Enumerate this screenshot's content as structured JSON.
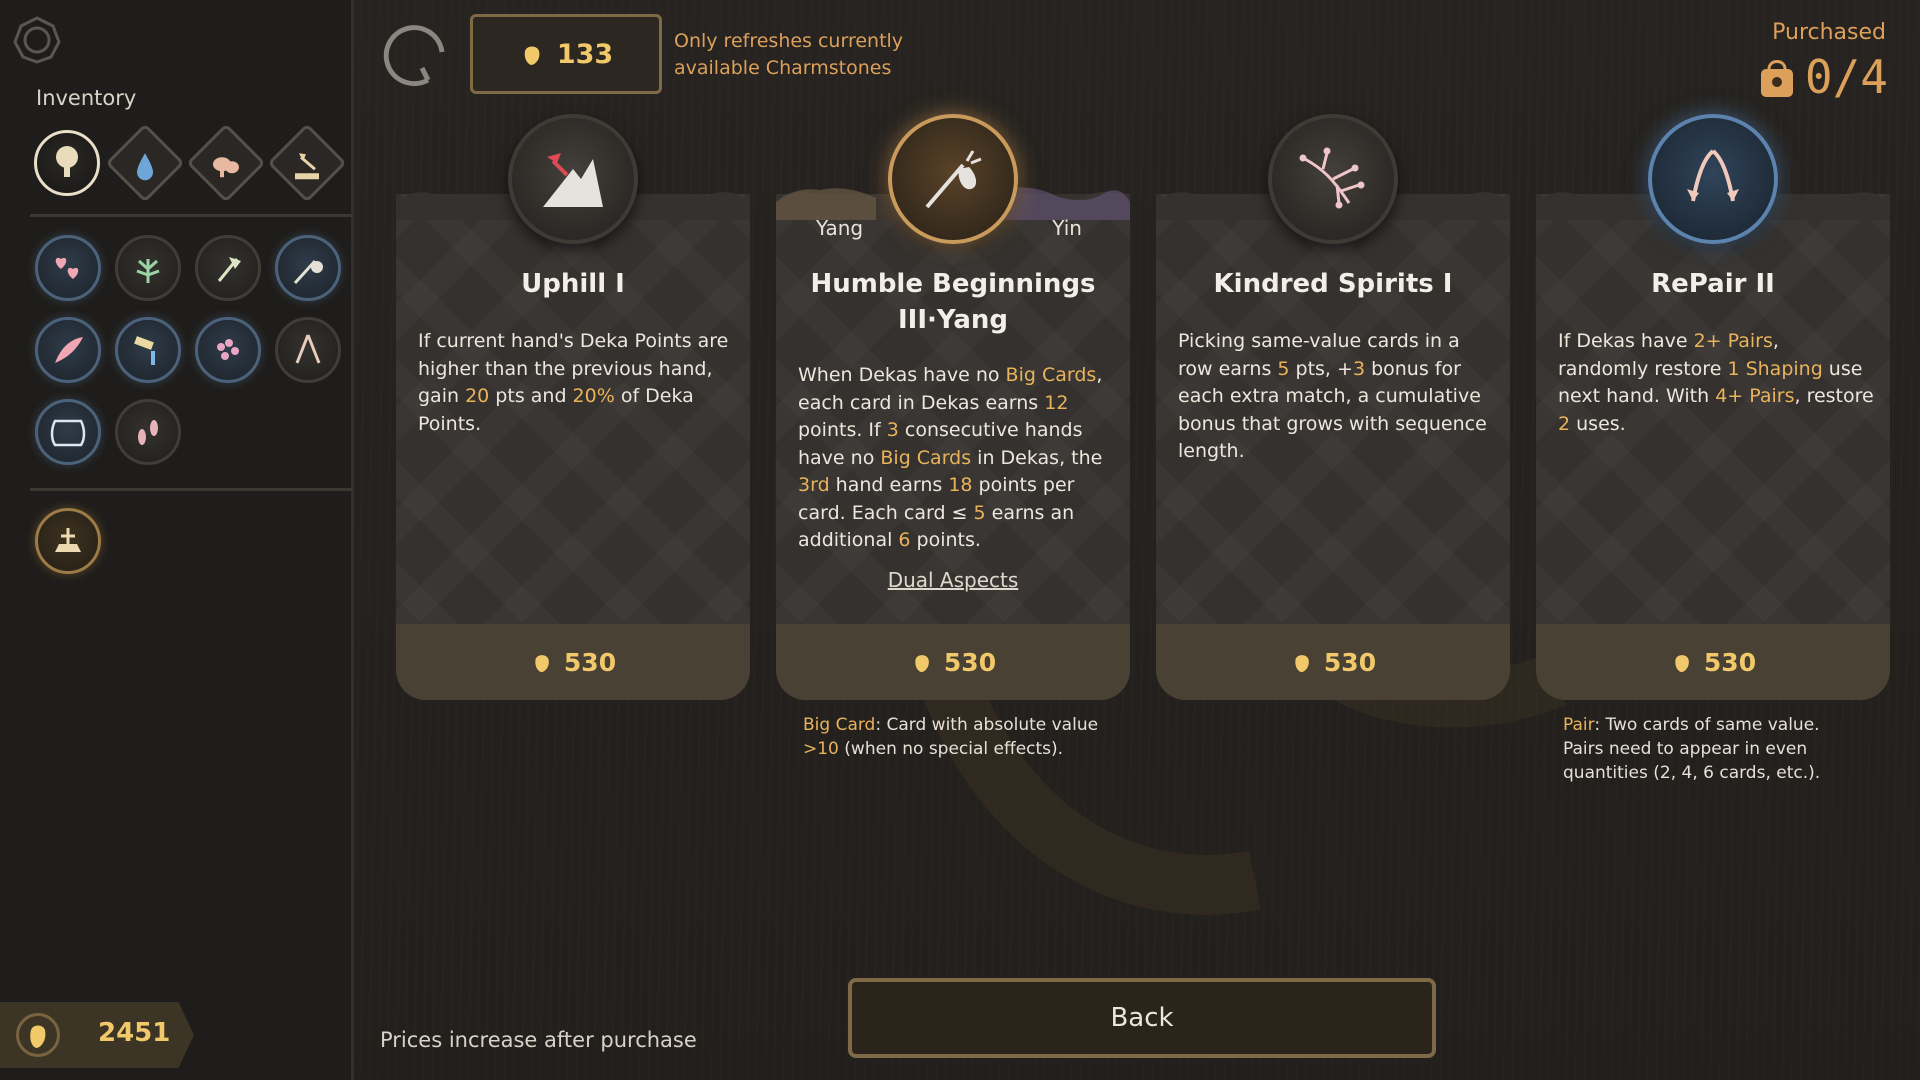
{
  "colors": {
    "accent": "#f2c96a",
    "highlight": "#e9b35b",
    "note": "#dca05a",
    "blue_rarity": "#5b83ad",
    "gold_rarity": "#c89a5c"
  },
  "sidebar": {
    "settings_icon": "gear-icon",
    "inventory_label": "Inventory",
    "categories": [
      {
        "icon": "tree-icon",
        "active": true
      },
      {
        "icon": "water-drop-icon",
        "active": false
      },
      {
        "icon": "mushroom-icon",
        "active": false
      },
      {
        "icon": "axe-stump-icon",
        "active": false
      }
    ],
    "charmstones": [
      {
        "icon": "hearts-icon",
        "rarity": "blue"
      },
      {
        "icon": "sprout-icon",
        "rarity": "gray"
      },
      {
        "icon": "axe-icon",
        "rarity": "gray"
      },
      {
        "icon": "staff-icon",
        "rarity": "blue"
      },
      {
        "icon": "feather-icon",
        "rarity": "blue"
      },
      {
        "icon": "pouring-icon",
        "rarity": "blue"
      },
      {
        "icon": "berries-icon",
        "rarity": "blue"
      },
      {
        "icon": "tweezers-icon",
        "rarity": "gray"
      },
      {
        "icon": "jar-icon",
        "rarity": "blue"
      },
      {
        "icon": "footprints-icon",
        "rarity": "gray"
      }
    ],
    "special": {
      "icon": "shrine-icon",
      "rarity": "gold"
    },
    "balance": "2451"
  },
  "topbar": {
    "refresh_cost": "133",
    "refresh_note": "Only refreshes currently available Charmstones",
    "purchased_label": "Purchased",
    "purchased_count": "0/4"
  },
  "cards": [
    {
      "icon": "mountain-pick-icon",
      "title": "Uphill I",
      "description": [
        {
          "t": "If current hand's Deka Points are higher than the previous hand, gain "
        },
        {
          "t": "20",
          "h": true
        },
        {
          "t": " pts and "
        },
        {
          "t": "20%",
          "h": true
        },
        {
          "t": " of Deka Points."
        }
      ],
      "price": "530"
    },
    {
      "icon": "staff-icon",
      "yang_label": "Yang",
      "yin_label": "Yin",
      "title": "Humble Beginnings III·Yang",
      "description": [
        {
          "t": "When Dekas have no "
        },
        {
          "t": "Big Cards",
          "h": true
        },
        {
          "t": ", each card in Dekas earns "
        },
        {
          "t": "12",
          "h": true
        },
        {
          "t": " points. If "
        },
        {
          "t": "3",
          "h": true
        },
        {
          "t": " consecutive hands have no "
        },
        {
          "t": "Big Cards",
          "h": true
        },
        {
          "t": " in Dekas, the "
        },
        {
          "t": "3rd",
          "h": true
        },
        {
          "t": " hand earns "
        },
        {
          "t": "18",
          "h": true
        },
        {
          "t": " points per card. Each card ≤ "
        },
        {
          "t": "5",
          "h": true
        },
        {
          "t": " earns an additional "
        },
        {
          "t": "6",
          "h": true
        },
        {
          "t": " points."
        }
      ],
      "link": "Dual Aspects",
      "price": "530",
      "tooltip": [
        {
          "t": "Big Card",
          "h": true
        },
        {
          "t": ": Card with absolute value "
        },
        {
          "t": ">10",
          "h": true
        },
        {
          "t": " (when no special effects)."
        }
      ]
    },
    {
      "icon": "branches-icon",
      "title": "Kindred Spirits I",
      "description": [
        {
          "t": "Picking same-value cards in a row earns "
        },
        {
          "t": "5",
          "h": true
        },
        {
          "t": " pts, +"
        },
        {
          "t": "3",
          "h": true
        },
        {
          "t": " bonus for each extra match, a cumulative bonus that grows with sequence length."
        }
      ],
      "price": "530"
    },
    {
      "icon": "tweezers-icon",
      "title": "RePair II",
      "description": [
        {
          "t": "If Dekas have "
        },
        {
          "t": "2+",
          "h": true
        },
        {
          "t": " "
        },
        {
          "t": "Pairs",
          "h": true
        },
        {
          "t": ", randomly restore "
        },
        {
          "t": "1",
          "h": true
        },
        {
          "t": " "
        },
        {
          "t": "Shaping",
          "h": true
        },
        {
          "t": " use next hand. With "
        },
        {
          "t": "4+",
          "h": true
        },
        {
          "t": " "
        },
        {
          "t": "Pairs",
          "h": true
        },
        {
          "t": ", restore "
        },
        {
          "t": "2",
          "h": true
        },
        {
          "t": " uses."
        }
      ],
      "price": "530",
      "tooltip": [
        {
          "t": "Pair",
          "h": true
        },
        {
          "t": ": Two cards of same value. Pairs need to appear in even quantities (2, 4, 6 cards, etc.)."
        }
      ]
    }
  ],
  "footer": {
    "note": "Prices increase after purchase",
    "back_label": "Back"
  }
}
